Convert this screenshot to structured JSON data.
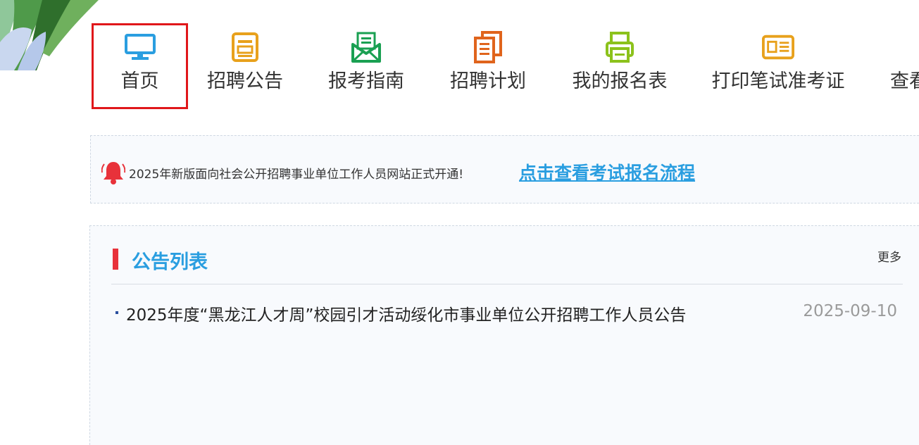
{
  "nav": {
    "items": [
      {
        "label": "首页",
        "icon": "monitor-icon",
        "color": "#2a9ee0",
        "active": true
      },
      {
        "label": "招聘公告",
        "icon": "announcement-icon",
        "color": "#e8a11c"
      },
      {
        "label": "报考指南",
        "icon": "guide-mail-icon",
        "color": "#1aa052"
      },
      {
        "label": "招聘计划",
        "icon": "plan-document-icon",
        "color": "#e0641c"
      },
      {
        "label": "我的报名表",
        "icon": "registration-printer-icon",
        "color": "#8cc21c"
      },
      {
        "label": "打印笔试准考证",
        "icon": "id-card-icon",
        "color": "#e8a11c"
      },
      {
        "label": "查看",
        "icon": "",
        "color": ""
      }
    ]
  },
  "notice": {
    "text": "2025年新版面向社会公开招聘事业单位工作人员网站正式开通!",
    "link": "点击查看考试报名流程",
    "icon": "bell-icon"
  },
  "announcements": {
    "title": "公告列表",
    "more": "更多",
    "items": [
      {
        "title": "2025年度“黑龙江人才周”校园引才活动绥化市事业单位公开招聘工作人员公告",
        "date": "2025-09-10"
      }
    ]
  },
  "colors": {
    "accent": "#2a9ee0",
    "active_border": "#e0171a",
    "title_bar": "#e8323a",
    "date": "#9a9a9a"
  }
}
